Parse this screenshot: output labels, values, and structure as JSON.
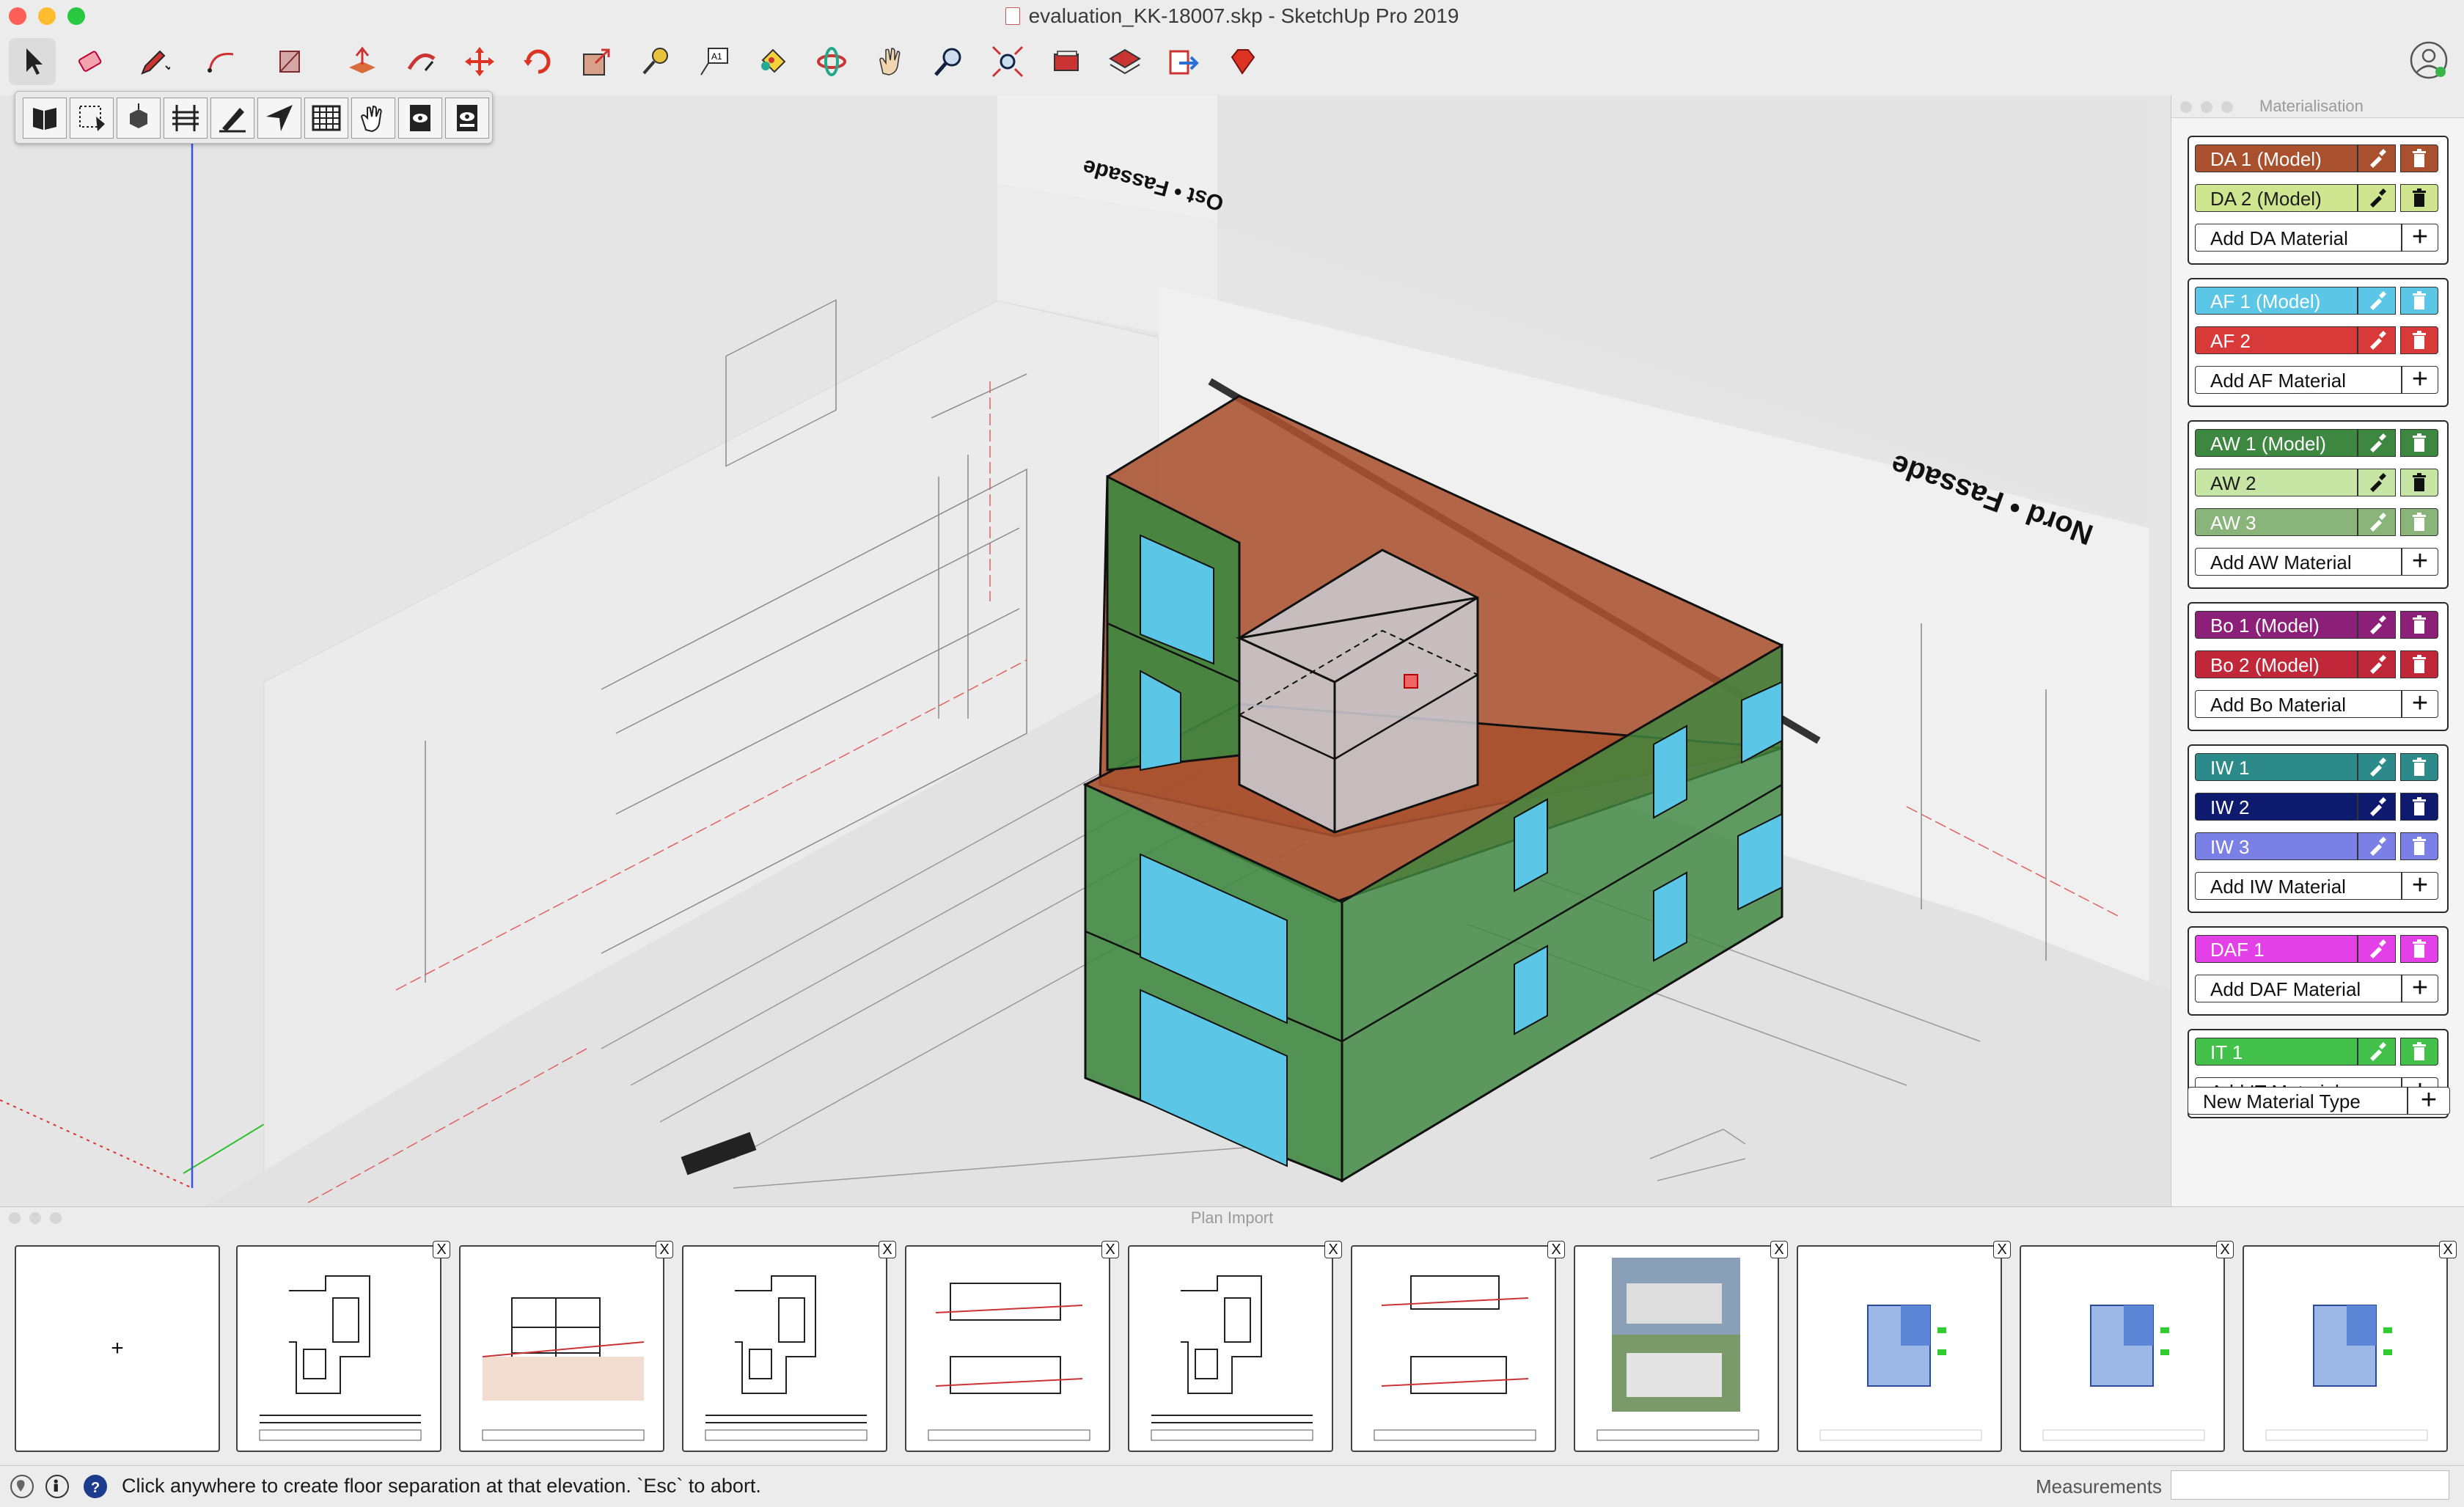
{
  "window": {
    "title": "evaluation_KK-18007.skp - SketchUp Pro 2019"
  },
  "toolbar": {
    "tools": [
      "select-tool-icon",
      "eraser-icon",
      "pencil-line-icon",
      "arc-icon",
      "rectangle-icon",
      "push-pull-icon",
      "follow-me-icon",
      "move-icon",
      "rotate-icon",
      "scale-icon",
      "tape-measure-icon",
      "text-icon",
      "paint-bucket-icon",
      "orbit-icon",
      "pan-icon",
      "zoom-icon",
      "zoom-extents-icon",
      "components-icon",
      "warehouse-icon",
      "extension-send-icon",
      "ruby-icon"
    ]
  },
  "palette": {
    "tools": [
      "plan-book-icon",
      "dotted-select-icon",
      "box-select-icon",
      "ladder-icon",
      "measure-pencil-icon",
      "direction-arrow-icon",
      "grid-icon",
      "hand-icon",
      "eye-doc-icon",
      "eye-doc-2-icon"
    ]
  },
  "viewport": {
    "facade_label_north": "Nord • Fassade",
    "facade_label_east": "Ost • Fassade"
  },
  "materialisation": {
    "title": "Materialisation",
    "groups": [
      {
        "items": [
          {
            "label": "DA 1 (Model)",
            "color": "#a9512f"
          },
          {
            "label": "DA 2 (Model)",
            "color": "#cfe58f"
          }
        ],
        "add": "Add DA Material"
      },
      {
        "items": [
          {
            "label": "AF 1 (Model)",
            "color": "#5bc6e6"
          },
          {
            "label": "AF 2",
            "color": "#d83a3a"
          }
        ],
        "add": "Add AF Material"
      },
      {
        "items": [
          {
            "label": "AW 1 (Model)",
            "color": "#3e8740"
          },
          {
            "label": "AW 2",
            "color": "#c7e6a6"
          },
          {
            "label": "AW 3",
            "color": "#8ab57a"
          }
        ],
        "add": "Add AW Material"
      },
      {
        "items": [
          {
            "label": "Bo 1 (Model)",
            "color": "#8c1f77"
          },
          {
            "label": "Bo 2 (Model)",
            "color": "#c0283a"
          }
        ],
        "add": "Add Bo Material"
      },
      {
        "items": [
          {
            "label": "IW 1",
            "color": "#2c8a8a"
          },
          {
            "label": "IW 2",
            "color": "#0e1a6e"
          },
          {
            "label": "IW 3",
            "color": "#7b80e6"
          }
        ],
        "add": "Add IW Material"
      },
      {
        "items": [
          {
            "label": "DAF 1",
            "color": "#e440e8"
          }
        ],
        "add": "Add DAF Material"
      },
      {
        "items": [
          {
            "label": "IT 1",
            "color": "#44c14a"
          }
        ],
        "add": "Add IT Material"
      }
    ],
    "new_type": "New Material Type"
  },
  "plan_import": {
    "title": "Plan Import",
    "add_label": "+",
    "close_label": "X",
    "thumbnails": [
      "floor-plan",
      "section",
      "floor-plan",
      "elevations",
      "floor-plan",
      "sections",
      "rendering",
      "colored-plan",
      "colored-plan",
      "colored-plan"
    ]
  },
  "status": {
    "message": "Click anywhere to create floor separation at that elevation. `Esc` to abort.",
    "measurements_label": "Measurements",
    "measurements_value": ""
  }
}
